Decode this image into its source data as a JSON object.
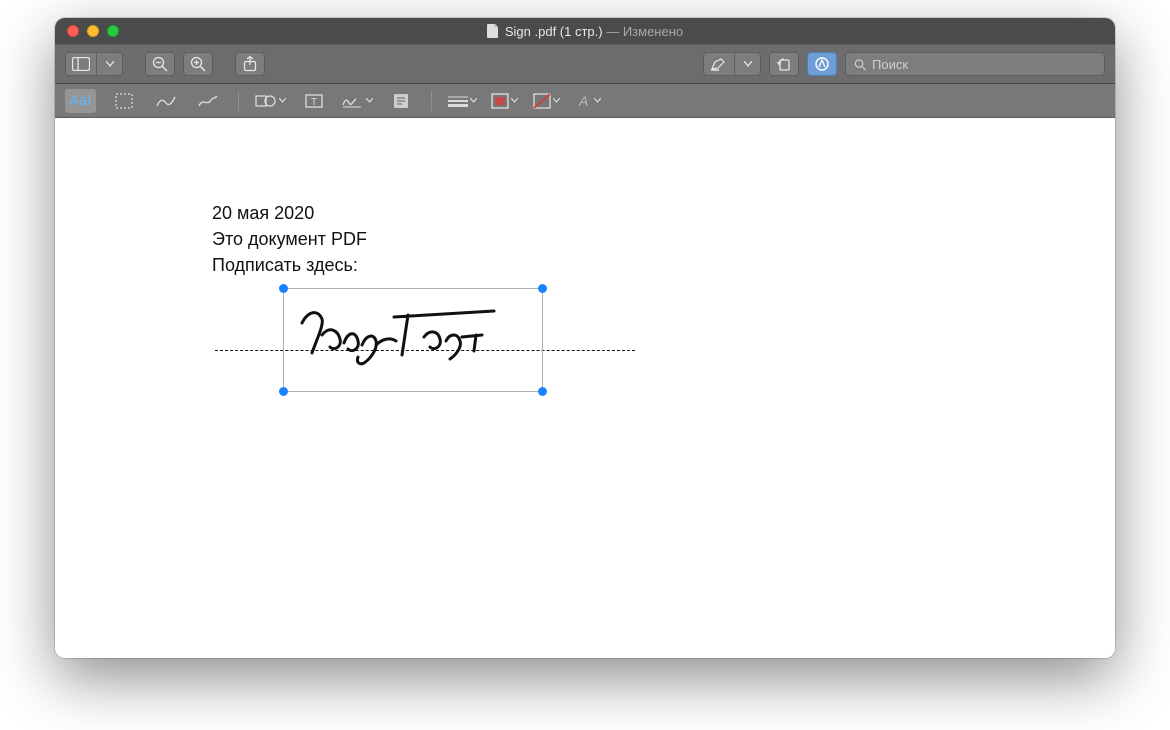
{
  "window": {
    "title_main": "Sign .pdf (1 стр.)",
    "title_suffix": " — Изменено",
    "traffic": {
      "close": "close",
      "minimize": "minimize",
      "zoom": "zoom"
    }
  },
  "toolbar1": {
    "sidebar_btn": "sidebar",
    "zoom_out": "zoom-out",
    "zoom_in": "zoom-in",
    "share": "share",
    "highlight": "highlight",
    "rotate": "rotate",
    "markup": "markup",
    "search_placeholder": "Поиск"
  },
  "toolbar2": {
    "text_tool_label": "AaI",
    "tools": [
      "text",
      "select",
      "sketch",
      "draw",
      "shapes",
      "textbox",
      "sign",
      "note",
      "line-style",
      "border-color",
      "fill-color",
      "text-style"
    ]
  },
  "document": {
    "line1": "20 мая 2020",
    "line2": "Это документ PDF",
    "line3": "Подписать здесь:",
    "signature_name": "signature-annotation"
  }
}
